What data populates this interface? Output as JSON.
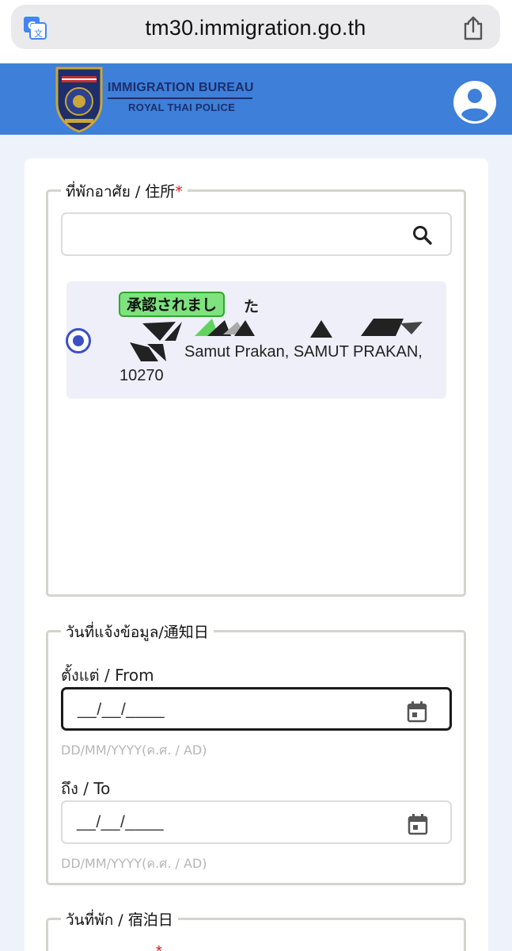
{
  "browser": {
    "url": "tm30.immigration.go.th"
  },
  "header": {
    "org_title": "IMMIGRATION BUREAU",
    "org_subtitle": "ROYAL THAI POLICE"
  },
  "residence": {
    "legend": "ที่พักอาศัย / 住所",
    "required_mark": "*",
    "search_value": "",
    "option": {
      "badge_text": "承認されまし",
      "badge_suffix": "た",
      "address_line": "Samut Prakan, SAMUT PRAKAN,",
      "postal_code": "10270",
      "selected": true
    }
  },
  "notify_date": {
    "legend": "วันที่แจ้งข้อมูล/通知日",
    "from_label": "ตั้งแต่ / From",
    "from_value": "__/__/____",
    "from_helper": "DD/MM/YYYY(ค.ศ. / AD)",
    "to_label": "ถึง / To",
    "to_value": "__/__/____",
    "to_helper": "DD/MM/YYYY(ค.ศ. / AD)"
  },
  "stay_date": {
    "legend": "วันที่พัก / 宿泊日",
    "required_mark": "*"
  },
  "colors": {
    "header_blue": "#3d7fd9",
    "radio_blue": "#3c4fc4",
    "badge_green": "#7ee27e",
    "required_red": "#d81b1b"
  }
}
